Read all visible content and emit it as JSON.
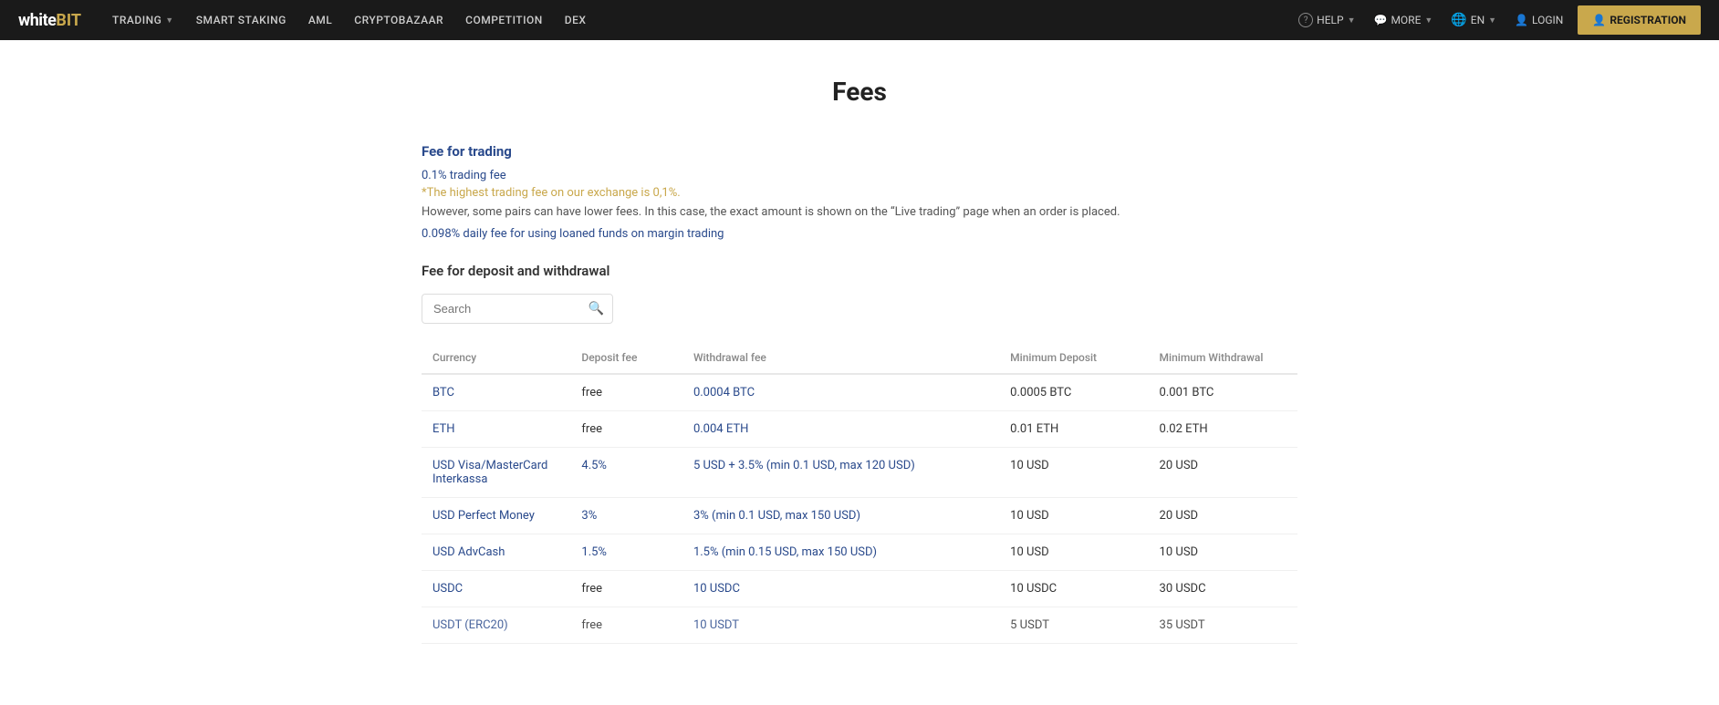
{
  "logo": {
    "white": "white",
    "bit": "BIT"
  },
  "navbar": {
    "items": [
      {
        "label": "TRADING",
        "hasDropdown": true
      },
      {
        "label": "SMART STAKING",
        "hasDropdown": false
      },
      {
        "label": "AML",
        "hasDropdown": false
      },
      {
        "label": "CRYPTOBAZAAR",
        "hasDropdown": false
      },
      {
        "label": "COMPETITION",
        "hasDropdown": false
      },
      {
        "label": "DEX",
        "hasDropdown": false
      }
    ],
    "right_items": [
      {
        "label": "HELP",
        "hasDropdown": true
      },
      {
        "label": "MORE",
        "hasDropdown": true
      },
      {
        "label": "EN",
        "hasDropdown": true
      }
    ],
    "login_label": "LOGIN",
    "register_label": "REGISTRATION"
  },
  "page": {
    "title": "Fees",
    "trading_section_title": "Fee for trading",
    "trading_fee": "0.1% trading fee",
    "trading_note": "*The highest trading fee on our exchange is 0,1%.",
    "trading_desc": "However, some pairs can have lower fees. In this case, the exact amount is shown on the “Live trading” page when an order is placed.",
    "margin_fee": "0.098% daily fee for using loaned funds on margin trading",
    "deposit_section_title": "Fee for deposit and withdrawal",
    "search_placeholder": "Search"
  },
  "table": {
    "headers": [
      {
        "key": "currency",
        "label": "Currency"
      },
      {
        "key": "deposit_fee",
        "label": "Deposit fee"
      },
      {
        "key": "withdrawal_fee",
        "label": "Withdrawal fee"
      },
      {
        "key": "min_deposit",
        "label": "Minimum Deposit"
      },
      {
        "key": "min_withdrawal",
        "label": "Minimum Withdrawal"
      }
    ],
    "rows": [
      {
        "currency": "BTC",
        "deposit_fee": "free",
        "withdrawal_fee": "0.0004 BTC",
        "min_deposit": "0.0005 BTC",
        "min_withdrawal": "0.001 BTC"
      },
      {
        "currency": "ETH",
        "deposit_fee": "free",
        "withdrawal_fee": "0.004 ETH",
        "min_deposit": "0.01 ETH",
        "min_withdrawal": "0.02 ETH"
      },
      {
        "currency": "USD Visa/MasterCard Interkassa",
        "deposit_fee": "4.5%",
        "withdrawal_fee": "5 USD + 3.5% (min 0.1 USD, max 120 USD)",
        "min_deposit": "10 USD",
        "min_withdrawal": "20 USD"
      },
      {
        "currency": "USD Perfect Money",
        "deposit_fee": "3%",
        "withdrawal_fee": "3% (min 0.1 USD, max 150 USD)",
        "min_deposit": "10 USD",
        "min_withdrawal": "20 USD"
      },
      {
        "currency": "USD AdvCash",
        "deposit_fee": "1.5%",
        "withdrawal_fee": "1.5% (min 0.15 USD, max 150 USD)",
        "min_deposit": "10 USD",
        "min_withdrawal": "10 USD"
      },
      {
        "currency": "USDC",
        "deposit_fee": "free",
        "withdrawal_fee": "10 USDC",
        "min_deposit": "10 USDC",
        "min_withdrawal": "30 USDC"
      },
      {
        "currency": "USDT (ERC20)",
        "deposit_fee": "free",
        "withdrawal_fee": "10 USDT",
        "min_deposit": "5 USDT",
        "min_withdrawal": "35 USDT"
      }
    ]
  }
}
